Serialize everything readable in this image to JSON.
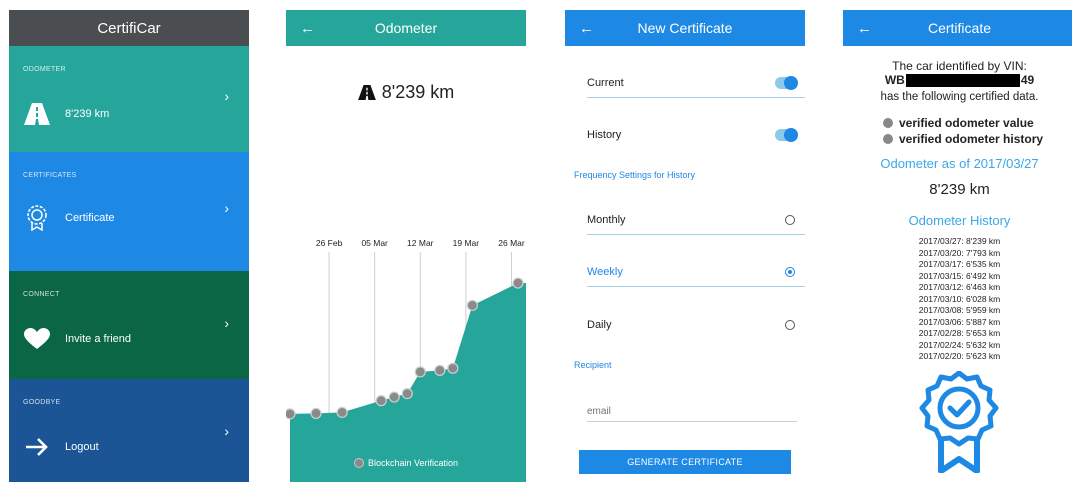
{
  "colors": {
    "teal": "#26a69a",
    "blue": "#1e88e5",
    "dark_green": "#0b6646",
    "navy": "#1b5596",
    "header_gray": "#4b4e51",
    "chart_fill": "#26a69a",
    "accent_text": "#3aa7e8"
  },
  "menu": {
    "app_title": "CertifiCar",
    "sections": [
      {
        "category": "ODOMETER",
        "label": "8'239 km",
        "icon": "road-icon"
      },
      {
        "category": "CERTIFICATES",
        "label": "Certificate",
        "icon": "badge-icon"
      },
      {
        "category": "CONNECT",
        "label": "Invite a friend",
        "icon": "heart-icon"
      },
      {
        "category": "GOODBYE",
        "label": "Logout",
        "icon": "arrow-right-icon"
      }
    ],
    "chevron": "›"
  },
  "odometer": {
    "back": "←",
    "title": "Odometer",
    "value": "8'239 km",
    "blockchain_label": "Blockchain Verification",
    "chart_data": {
      "type": "area",
      "x": [
        "2017/02/20",
        "2017/02/24",
        "2017/02/28",
        "2017/03/06",
        "2017/03/08",
        "2017/03/10",
        "2017/03/12",
        "2017/03/15",
        "2017/03/17",
        "2017/03/20",
        "2017/03/27"
      ],
      "values": [
        5623,
        5632,
        5653,
        5887,
        5959,
        6028,
        6463,
        6492,
        6535,
        7793,
        8239
      ],
      "xtick_labels": [
        "26 Feb",
        "05 Mar",
        "12 Mar",
        "19 Mar",
        "26 Mar"
      ],
      "xtick_dates": [
        "2017/02/26",
        "2017/03/05",
        "2017/03/12",
        "2017/03/19",
        "2017/03/26"
      ],
      "grid": "vertical"
    }
  },
  "new_certificate": {
    "back": "←",
    "title": "New Certificate",
    "toggles": [
      {
        "label": "Current",
        "on": true
      },
      {
        "label": "History",
        "on": true
      }
    ],
    "frequency_heading": "Frequency Settings for History",
    "frequency_options": [
      {
        "label": "Monthly",
        "selected": false
      },
      {
        "label": "Weekly",
        "selected": true
      },
      {
        "label": "Daily",
        "selected": false
      }
    ],
    "recipient_heading": "Recipient",
    "email_placeholder": "email",
    "generate_label": "GENERATE CERTIFICATE"
  },
  "certificate": {
    "back": "←",
    "title": "Certificate",
    "intro_line": "The car identified by VIN:",
    "vin_prefix": "WB",
    "vin_suffix": "49",
    "data_line": "has the following certified data.",
    "verified_items": [
      "verified odometer value",
      "verified odometer history"
    ],
    "odometer_as_of": "Odometer as of 2017/03/27",
    "odometer_value": "8'239 km",
    "history_heading": "Odometer History",
    "history": [
      "2017/03/27: 8'239 km",
      "2017/03/20: 7'793 km",
      "2017/03/17: 6'535 km",
      "2017/03/15: 6'492 km",
      "2017/03/12: 6'463 km",
      "2017/03/10: 6'028 km",
      "2017/03/08: 5'959 km",
      "2017/03/06: 5'887 km",
      "2017/02/28: 5'653 km",
      "2017/02/24: 5'632 km",
      "2017/02/20: 5'623 km"
    ]
  }
}
